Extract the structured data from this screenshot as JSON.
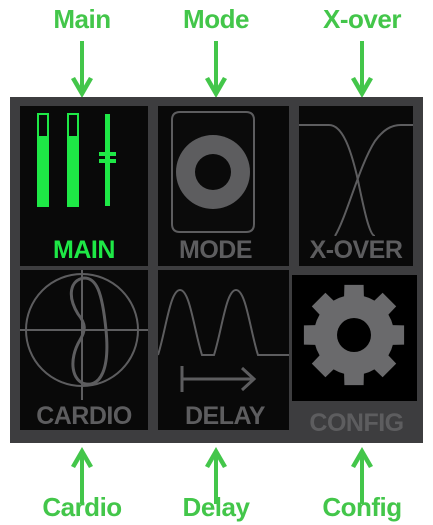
{
  "colors": {
    "accent_green": "#43c64a",
    "active_green": "#1ee846",
    "panel_bg": "#3d3d3f",
    "tile_bg": "#090909",
    "inactive_gray": "#5d5d5f",
    "config_gear": "#6a6a6c"
  },
  "callouts": {
    "main": "Main",
    "mode": "Mode",
    "xover": "X-over",
    "cardio": "Cardio",
    "delay": "Delay",
    "config": "Config"
  },
  "tiles": {
    "main": {
      "label": "MAIN",
      "icon": "level-meters-icon",
      "selected": true
    },
    "mode": {
      "label": "MODE",
      "icon": "speaker-icon",
      "selected": false
    },
    "xover": {
      "label": "X-OVER",
      "icon": "crossover-curve-icon",
      "selected": false
    },
    "cardio": {
      "label": "CARDIO",
      "icon": "cardioid-pattern-icon",
      "selected": false
    },
    "delay": {
      "label": "DELAY",
      "icon": "delay-waveform-icon",
      "selected": false
    },
    "config": {
      "label": "CONFIG",
      "icon": "gear-icon",
      "selected": false
    }
  }
}
